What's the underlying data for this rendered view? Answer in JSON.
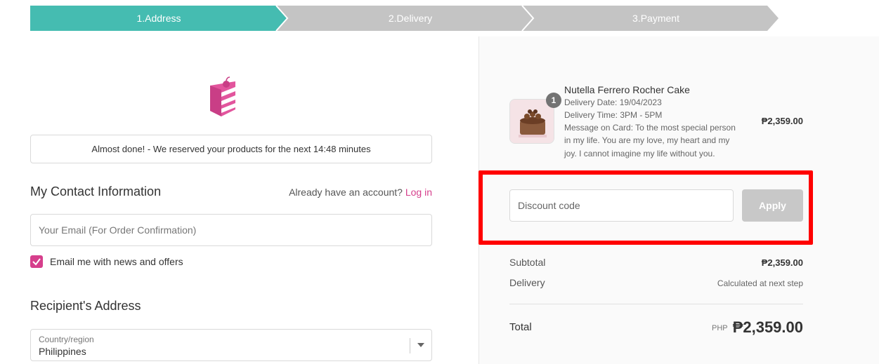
{
  "steps": [
    {
      "label": "1.Address",
      "active": true
    },
    {
      "label": "2.Delivery",
      "active": false
    },
    {
      "label": "3.Payment",
      "active": false
    }
  ],
  "colors": {
    "active_step": "#45bcb1",
    "inactive_step": "#c4c4c4",
    "accent": "#d63f8c",
    "highlight": "#ff0000"
  },
  "notice": "Almost done! - We reserved your products for the next 14:48 minutes",
  "contact": {
    "title": "My Contact Information",
    "account_prompt": "Already have an account?",
    "login_link": "Log in",
    "email_placeholder": "Your Email (For Order Confirmation)",
    "newsletter_label": "Email me with news and offers",
    "newsletter_checked": true
  },
  "address": {
    "title": "Recipient's Address",
    "country_label": "Country/region",
    "country_value": "Philippines"
  },
  "order": {
    "item": {
      "quantity": "1",
      "name": "Nutella Ferrero Rocher Cake",
      "delivery_date": "Delivery Date: 19/04/2023",
      "delivery_time": "Delivery Time: 3PM - 5PM",
      "message_line1": "Message on Card: To the most special person",
      "message_line2": "in my life. You are my love, my heart and my",
      "message_line3": "joy. I cannot imagine my life without you.",
      "price": "₱2,359.00"
    },
    "discount_placeholder": "Discount code",
    "apply_label": "Apply",
    "subtotal_label": "Subtotal",
    "subtotal_value": "₱2,359.00",
    "delivery_label": "Delivery",
    "delivery_value": "Calculated at next step",
    "total_label": "Total",
    "total_currency": "PHP",
    "total_value": "₱2,359.00"
  }
}
